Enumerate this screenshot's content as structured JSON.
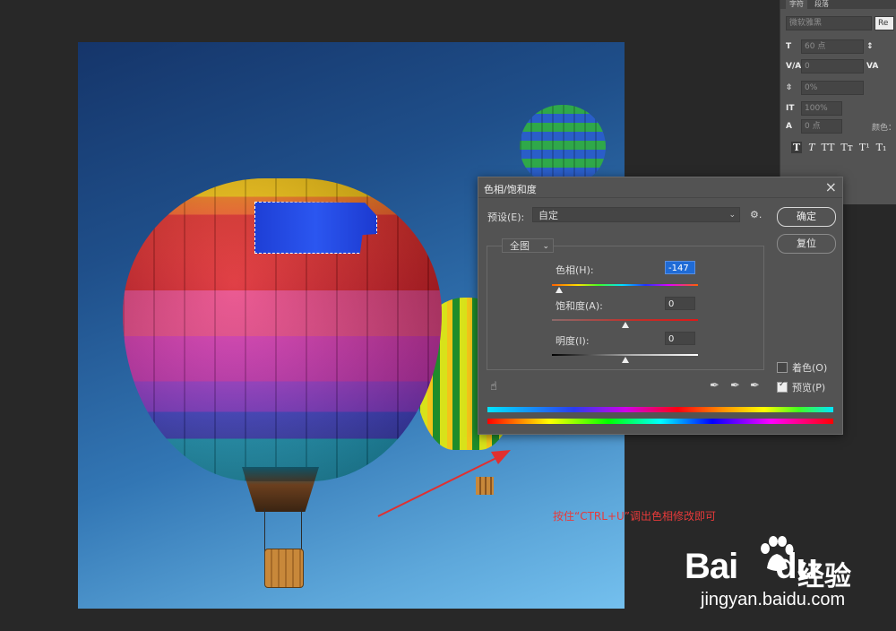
{
  "char_panel": {
    "tabs": [
      "字符",
      "段落"
    ],
    "font_family": "微软雅黑",
    "font_style": "Re",
    "font_size": "60 点",
    "kerning": "0",
    "tracking_percent": "0%",
    "vertical_scale": "100%",
    "baseline_shift": "0 点",
    "color_label": "颜色：",
    "aa_label": "a"
  },
  "dialog": {
    "title": "色相/饱和度",
    "preset_label": "预设(E):",
    "preset_value": "自定",
    "ok_label": "确定",
    "reset_label": "复位",
    "channel_value": "全图",
    "hue_label": "色相(H):",
    "hue_value": "-147",
    "hue_fraction": 0.05,
    "saturation_label": "饱和度(A):",
    "saturation_value": "0",
    "saturation_fraction": 0.5,
    "lightness_label": "明度(I):",
    "lightness_value": "0",
    "lightness_fraction": 0.5,
    "colorize_label": "着色(O)",
    "colorize_checked": false,
    "preview_label": "预览(P)",
    "preview_checked": true
  },
  "annotation": {
    "text": "按住“CTRL+U”调出色相修改即可",
    "color": "#e83a3a"
  },
  "watermark": {
    "brand": "Bai",
    "brand_suffix": "du",
    "cn_label": "经验",
    "url": "jingyan.baidu.com"
  }
}
